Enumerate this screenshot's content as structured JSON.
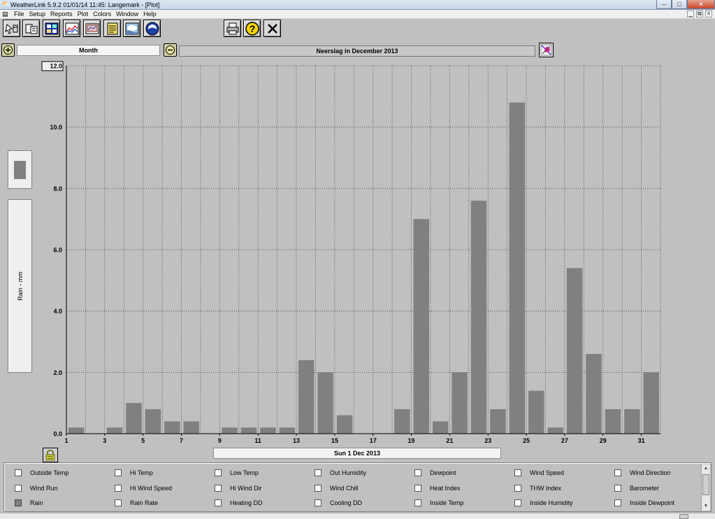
{
  "window": {
    "title": "WeatherLink 5.9.2  01/01/14  11:45: Langemark - [Plot]",
    "app_icon": "weatherlink-icon",
    "buttons": {
      "minimize": "–",
      "maximize": "□",
      "close": "✕"
    },
    "mdi_buttons": {
      "minimize": "_",
      "restore": "⧉",
      "close": "×"
    }
  },
  "menu": {
    "items": [
      "File",
      "Setup",
      "Reports",
      "Plot",
      "Colors",
      "Window",
      "Help"
    ]
  },
  "toolbar": {
    "buttons": [
      {
        "icon": "select-station-icon"
      },
      {
        "icon": "walk-download-icon"
      },
      {
        "icon": "bulletin-icon"
      },
      {
        "icon": "summary-plot-icon"
      },
      {
        "icon": "strip-chart-icon"
      },
      {
        "icon": "notes-icon"
      },
      {
        "icon": "weather-icon"
      },
      {
        "icon": "noaa-report-icon"
      },
      {
        "icon": "print-icon"
      },
      {
        "icon": "help-icon"
      },
      {
        "icon": "close-icon"
      }
    ]
  },
  "controls": {
    "period": "Month",
    "plot_title": "Neerslag in December 2013",
    "date": "Sun 1 Dec 2013",
    "colors": {
      "bar": "#808080",
      "plot_bg": "#c0c0c0",
      "grid": "#404040"
    }
  },
  "side_panel": {
    "axis_label": "Rain - mm"
  },
  "chart_data": {
    "type": "bar",
    "title": "Neerslag in December 2013",
    "ylabel": "Rain - mm",
    "xlabel": "Sun 1 Dec 2013",
    "ylim": [
      0,
      12
    ],
    "y_ticks": [
      "0.0",
      "2.0",
      "4.0",
      "6.0",
      "8.0",
      "10.0",
      "12.0"
    ],
    "x_ticks": [
      "1",
      "3",
      "5",
      "7",
      "9",
      "11",
      "13",
      "15",
      "17",
      "19",
      "21",
      "23",
      "25",
      "27",
      "29",
      "31"
    ],
    "grid": true,
    "categories": [
      1,
      2,
      3,
      4,
      5,
      6,
      7,
      8,
      9,
      10,
      11,
      12,
      13,
      14,
      15,
      16,
      17,
      18,
      19,
      20,
      21,
      22,
      23,
      24,
      25,
      26,
      27,
      28,
      29,
      30,
      31
    ],
    "values": [
      0.2,
      0.0,
      0.2,
      1.0,
      0.8,
      0.4,
      0.4,
      0.0,
      0.2,
      0.2,
      0.2,
      0.2,
      2.4,
      2.0,
      0.6,
      0.0,
      0.0,
      0.8,
      7.0,
      0.4,
      2.0,
      7.6,
      0.8,
      10.8,
      1.4,
      0.2,
      5.4,
      2.6,
      0.8,
      0.8,
      2.0
    ]
  },
  "checkboxes": [
    {
      "label": "Outside Temp",
      "checked": false
    },
    {
      "label": "Hi Temp",
      "checked": false
    },
    {
      "label": "Low Temp",
      "checked": false
    },
    {
      "label": "Out Humidity",
      "checked": false
    },
    {
      "label": "Dewpoint",
      "checked": false
    },
    {
      "label": "Wind Speed",
      "checked": false
    },
    {
      "label": "Wind Direction",
      "checked": false
    },
    {
      "label": "Wind Run",
      "checked": false
    },
    {
      "label": "Hi Wind Speed",
      "checked": false
    },
    {
      "label": "Hi Wind Dir",
      "checked": false
    },
    {
      "label": "Wind Chill",
      "checked": false
    },
    {
      "label": "Heat Index",
      "checked": false
    },
    {
      "label": "THW Index",
      "checked": false
    },
    {
      "label": "Barometer",
      "checked": false
    },
    {
      "label": "Rain",
      "checked": true
    },
    {
      "label": "Rain Rate",
      "checked": false
    },
    {
      "label": "Heating DD",
      "checked": false
    },
    {
      "label": "Cooling DD",
      "checked": false
    },
    {
      "label": "Inside Temp",
      "checked": false
    },
    {
      "label": "Inside Humidity",
      "checked": false
    },
    {
      "label": "Inside Dewpoint",
      "checked": false
    }
  ]
}
